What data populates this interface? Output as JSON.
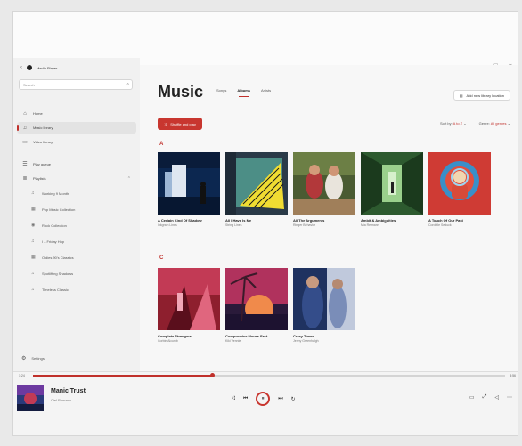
{
  "app": {
    "name": "Media Player"
  },
  "window_controls": [
    "–",
    "□",
    "×"
  ],
  "sidebar": {
    "search_placeholder": "Search",
    "nav": [
      {
        "label": "Home",
        "icon": "⌂"
      },
      {
        "label": "Music library",
        "icon": "♫"
      },
      {
        "label": "Video library",
        "icon": "▭"
      },
      {
        "label": "Play queue",
        "icon": "☰"
      },
      {
        "label": "Playlists",
        "icon": "≣"
      }
    ],
    "playlists": [
      {
        "label": "Working 9 Month",
        "icon": "♫"
      },
      {
        "label": "Pop Music Collection",
        "icon": "▦"
      },
      {
        "label": "Rock Collection",
        "icon": "◉"
      },
      {
        "label": "I – Friday Hop",
        "icon": "♫"
      },
      {
        "label": "Oldies 90's Classics",
        "icon": "▦"
      },
      {
        "label": "Spotlifting Shadows",
        "icon": "♫"
      },
      {
        "label": "Timeless Classic",
        "icon": "♫"
      }
    ],
    "settings": "Settings"
  },
  "main": {
    "title": "Music",
    "tabs": [
      "Songs",
      "Albums",
      "Artists"
    ],
    "add_folder": "Add new library location",
    "shuffle": "Shuffle and play",
    "sort_label": "Sort by:",
    "sort_value": "A to Z",
    "genre_label": "Genre:",
    "genre_value": "All genres",
    "sections": [
      {
        "letter": "A",
        "albums": [
          {
            "title": "A Certain Kind Of Shadow",
            "artist": "Inkgrain Lines"
          },
          {
            "title": "All I Have Is Me",
            "artist": "String Lines"
          },
          {
            "title": "All The Arguments",
            "artist": "Ringer Behavior"
          },
          {
            "title": "Ambit & Ambiguities",
            "artist": "Mia Reimann"
          },
          {
            "title": "A Touch Of Our Past",
            "artist": "Cordelle Seduck"
          }
        ]
      },
      {
        "letter": "C",
        "albums": [
          {
            "title": "Complete Strangers",
            "artist": "Corbin Alcumb"
          },
          {
            "title": "Compromise Moves Fast",
            "artist": "Kiki Vennie"
          },
          {
            "title": "Crazy Times",
            "artist": "Jenny Greenhalgh"
          }
        ]
      }
    ]
  },
  "player": {
    "title": "Manic Trust",
    "artist": "Ciel Romano",
    "time_elapsed": "1:24",
    "time_total": "3:56",
    "progress": 0.38,
    "controls": [
      "⤨",
      "⏮",
      "⏸",
      "⏭",
      "↻"
    ],
    "right_controls": [
      "▭",
      "⤢",
      "◁",
      "⋯"
    ]
  },
  "colors": {
    "accent": "#c0302b"
  }
}
